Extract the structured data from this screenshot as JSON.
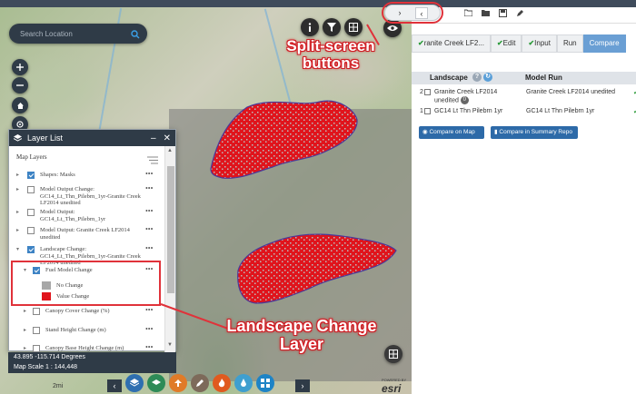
{
  "search": {
    "placeholder": "Search Location"
  },
  "layer_list": {
    "title": "Layer List",
    "subtitle": "Map Layers",
    "rows": [
      {
        "label": "Shapes: Masks",
        "checked": true
      },
      {
        "label": "Model Output Change: GC14_Lt_Thn_Pilebrn_1yr-Granite Creek LF2014 unedited",
        "checked": false
      },
      {
        "label": "Model Output: GC14_Lt_Thn_Pilebrn_1yr",
        "checked": false
      },
      {
        "label": "Model Output: Granite Creek LF2014 unedited",
        "checked": false
      },
      {
        "label": "Landscape Change: GC14_Lt_Thn_Pilebrn_1yr-Granite Creek LF2014 unedited",
        "checked": true
      },
      {
        "label": "Fuel Model Change",
        "checked": true
      },
      {
        "label": "Canopy Cover Change (%)",
        "checked": false
      },
      {
        "label": "Stand Height Change (m)",
        "checked": false
      },
      {
        "label": "Canopy Base Height Change (m)",
        "checked": false
      }
    ],
    "legend": [
      {
        "label": "No Change",
        "color": "#a8a8a8"
      },
      {
        "label": "Value Change",
        "color": "#e0141c"
      }
    ],
    "more": "•••"
  },
  "coords": "43.895 -115.714 Degrees",
  "scale": "Map Scale 1 : 144,448",
  "km_label": "2mi",
  "esri": {
    "logo": "esri",
    "powered": "POWERED BY"
  },
  "callouts": {
    "split": "Split-screen buttons",
    "landscape": "Landscape Change Layer"
  },
  "panel": {
    "tabs": [
      {
        "label": "ranite Creek LF2...",
        "check": "✔"
      },
      {
        "label": "Edit",
        "check": "✔"
      },
      {
        "label": "Input",
        "check": "✔"
      },
      {
        "label": "Run",
        "check": ""
      },
      {
        "label": "Compare",
        "check": ""
      }
    ],
    "table": {
      "col_landscape": "Landscape",
      "col_model_run": "Model Run",
      "rows": [
        {
          "idx": "2",
          "name": "Granite Creek LF2014 unedited",
          "badge": "0",
          "run": "Granite Creek LF2014 unedited"
        },
        {
          "idx": "1",
          "name": "GC14 Lt Thn Pilebrn 1yr",
          "badge": "",
          "run": "GC14 Lt Thn Pilebrn 1yr"
        }
      ]
    },
    "buttons": {
      "compare_map": "Compare on Map",
      "compare_summary": "Compare in Summary Repo"
    }
  },
  "colors": {
    "accent": "#2d6aa8",
    "highlight": "#e0323a",
    "dark": "#2f3b47",
    "burn": "#e0141c"
  }
}
